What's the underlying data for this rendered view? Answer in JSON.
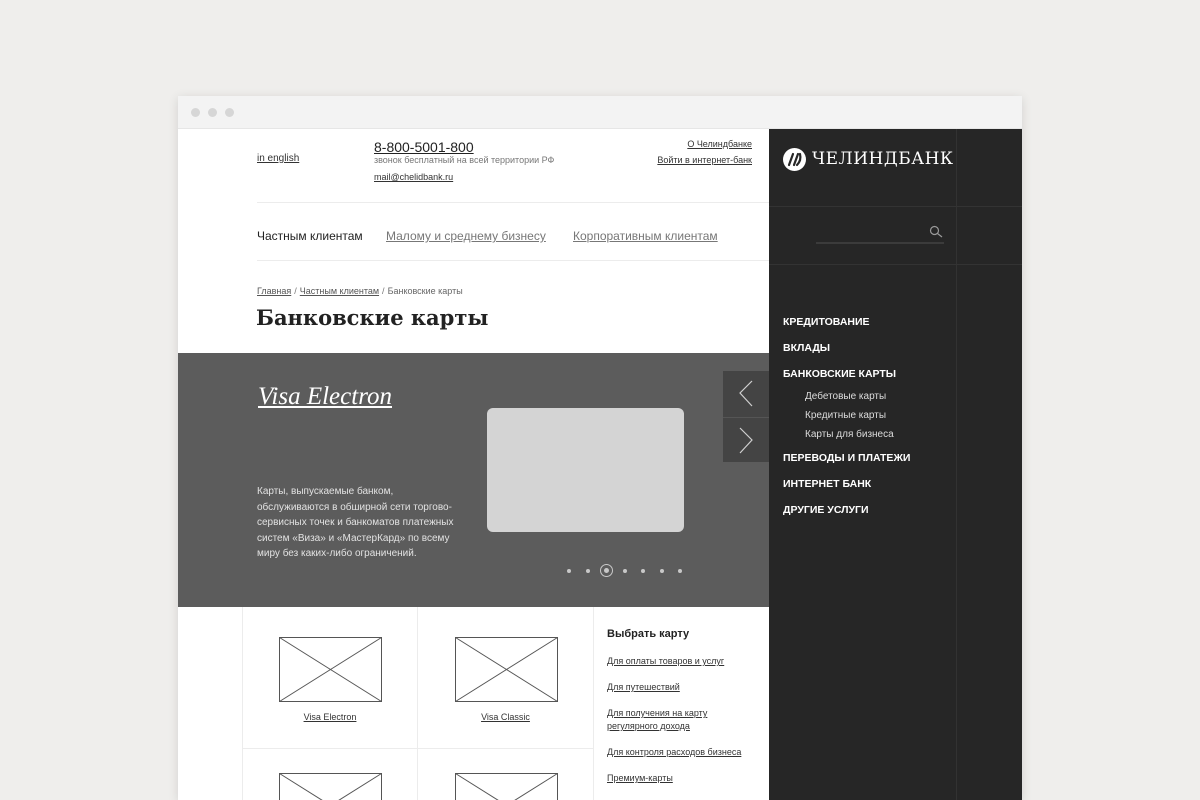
{
  "window": {
    "dots": [
      "dot",
      "dot",
      "dot"
    ]
  },
  "header": {
    "lang_link": "in english",
    "phone": "8-800-5001-800",
    "phone_note": "звонок бесплатный на всей территории РФ",
    "email": "mail@chelidbank.ru",
    "about_link": "О Челиндбанке",
    "login_link": "Войти в интернет-банк"
  },
  "segments": [
    {
      "label": "Частным клиентам",
      "active": true
    },
    {
      "label": "Малому и среднему бизнесу",
      "active": false
    },
    {
      "label": "Корпоративным клиентам",
      "active": false
    }
  ],
  "breadcrumb": {
    "items": [
      "Главная",
      "Частным клиентам"
    ],
    "separator": "/",
    "current": "Банковские карты"
  },
  "page_title": "Банковские карты",
  "hero": {
    "title": "Visa Electron",
    "description": "Карты, выпускаемые банком, обслуживаются в обширной сети торгово-сервисных точек и банкоматов платежных систем «Виза» и «МастерКард» по всему миру без каких-либо ограничений.",
    "slide_count": 7,
    "active_slide": 3,
    "colors": {
      "background": "#5c5c5c",
      "card": "#d4d4d4",
      "arrows": "#444444"
    }
  },
  "cards": [
    {
      "caption": "Visa Electron"
    },
    {
      "caption": "Visa Classic"
    },
    {
      "caption": ""
    },
    {
      "caption": ""
    }
  ],
  "choose": {
    "title": "Выбрать карту",
    "links": [
      "Для оплаты товаров и услуг",
      "Для путешествий",
      "Для получения на карту регулярного дохода",
      "Для контроля расходов бизнеса",
      "Премиум-карты"
    ]
  },
  "sidebar": {
    "brand": "ЧЕЛИНДБАНК",
    "search": {
      "placeholder": "",
      "value": ""
    },
    "menu": [
      {
        "label": "Кредитование",
        "children": []
      },
      {
        "label": "Вклады",
        "children": []
      },
      {
        "label": "Банковские карты",
        "children": [
          "Дебетовые карты",
          "Кредитные карты",
          "Карты для бизнеса"
        ]
      },
      {
        "label": "Переводы и платежи",
        "children": []
      },
      {
        "label": "Интернет банк",
        "children": []
      },
      {
        "label": "Другие услуги",
        "children": []
      }
    ],
    "colors": {
      "background": "#262626"
    }
  }
}
